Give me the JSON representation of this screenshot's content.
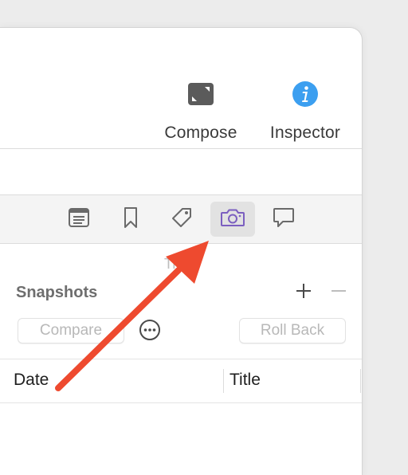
{
  "toolbar": {
    "compose_label": "Compose",
    "inspector_label": "Inspector",
    "compose_icon": "compose-icon",
    "inspector_icon": "info-icon"
  },
  "inspector_tabs": [
    {
      "icon": "document-icon",
      "active": false
    },
    {
      "icon": "bookmark-icon",
      "active": false
    },
    {
      "icon": "tag-icon",
      "active": false
    },
    {
      "icon": "camera-icon",
      "active": true
    },
    {
      "icon": "comment-icon",
      "active": false
    }
  ],
  "snapshots": {
    "title": "Snapshots",
    "add_label": "+",
    "remove_label": "−",
    "compare_label": "Compare",
    "rollback_label": "Roll Back",
    "partial_label": "Ti"
  },
  "table": {
    "columns": [
      "Date",
      "Title"
    ]
  },
  "colors": {
    "accent_purple": "#7b5fc0",
    "info_blue": "#3c9ff0",
    "arrow_red": "#ee4a2f"
  }
}
